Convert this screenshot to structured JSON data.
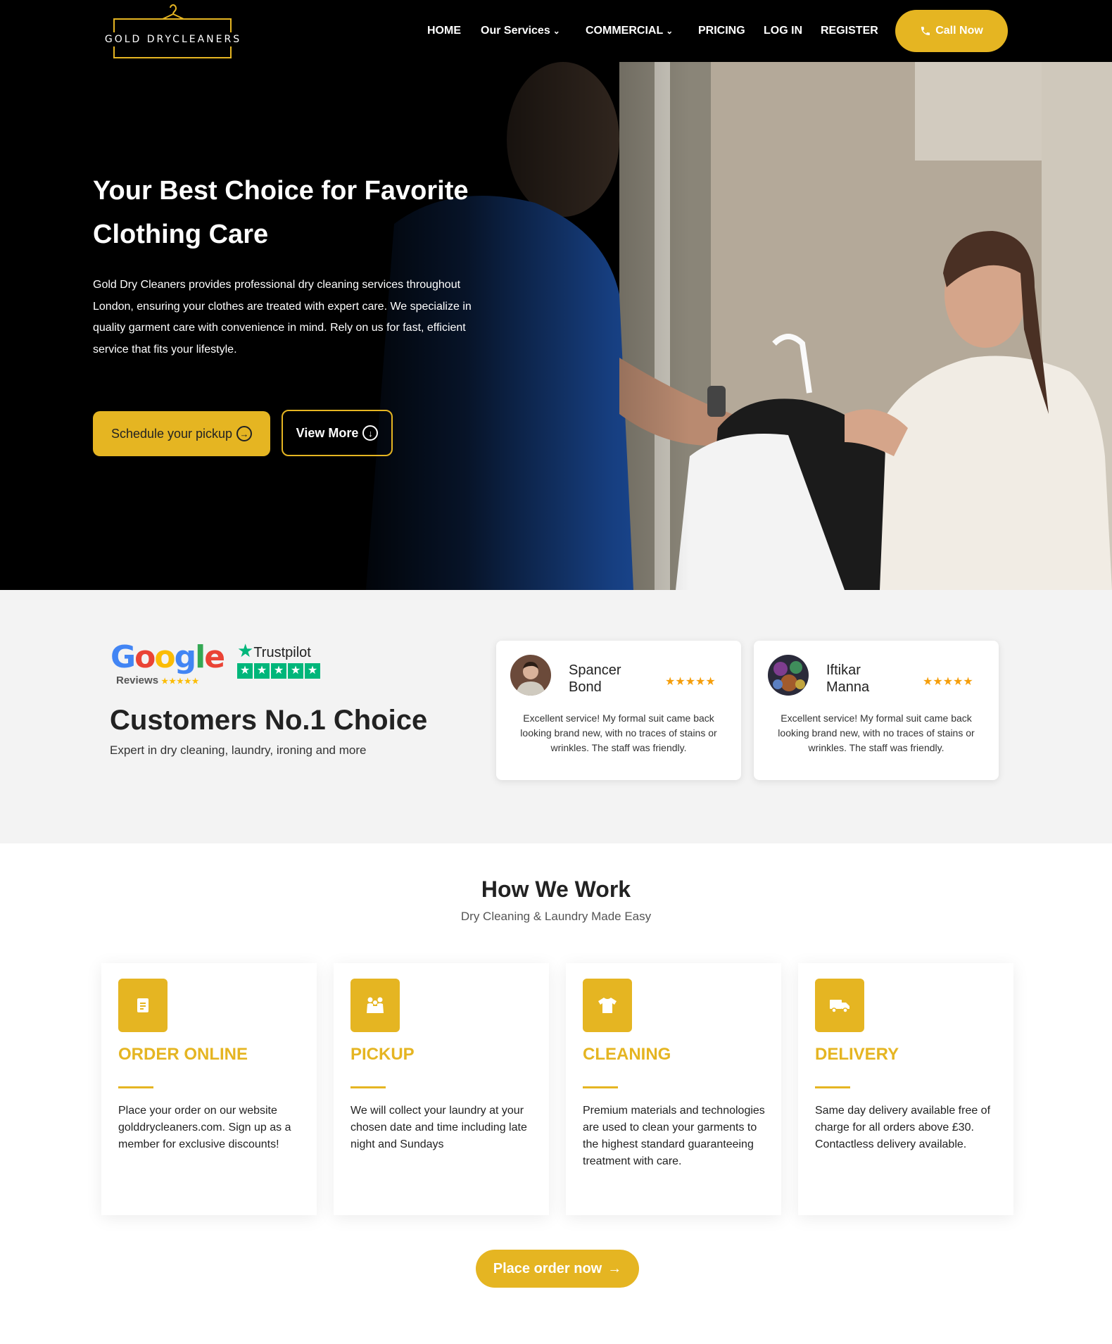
{
  "brand": {
    "logo_text": "GOLD DRYCLEANERS",
    "accent": "#e5b522"
  },
  "nav": {
    "items": [
      {
        "label": "HOME"
      },
      {
        "label": "Our Services"
      },
      {
        "label": "COMMERCIAL"
      },
      {
        "label": "PRICING"
      },
      {
        "label": "LOG IN"
      },
      {
        "label": "REGISTER"
      }
    ],
    "call_label": "Call Now"
  },
  "hero": {
    "title": "Your Best Choice for Favorite Clothing Care",
    "description": "Gold Dry Cleaners provides professional dry cleaning services throughout London, ensuring your clothes are treated with expert care. We specialize in quality garment care with convenience in mind. Rely on us for fast, efficient service that fits your lifestyle.",
    "schedule_label": "Schedule your pickup",
    "view_more_label": "View More"
  },
  "reviews": {
    "google_word": "Google",
    "google_sub": "Reviews",
    "trustpilot_word": "Trustpilot",
    "title": "Customers No.1 Choice",
    "subtitle": "Expert in dry cleaning, laundry, ironing and more",
    "cards": [
      {
        "name": "Spancer Bond",
        "rating": 5,
        "text": "Excellent service! My formal suit came back looking brand new, with no traces of stains or wrinkles. The staff was friendly."
      },
      {
        "name": "Iftikar Manna",
        "rating": 5,
        "text": "Excellent service! My formal suit came back looking brand new, with no traces of stains or wrinkles. The staff was friendly."
      }
    ]
  },
  "how": {
    "title": "How We Work",
    "subtitle": "Dry Cleaning & Laundry Made Easy",
    "steps": [
      {
        "title": "ORDER ONLINE",
        "icon": "document-icon",
        "text": "Place your order on our website golddrycleaners.com. Sign up as a member for exclusive discounts!"
      },
      {
        "title": "PICKUP",
        "icon": "people-icon",
        "text": "We will collect your laundry at your chosen date and time including late night and Sundays"
      },
      {
        "title": "CLEANING",
        "icon": "tshirt-icon",
        "text": "Premium materials and technologies are used to clean your garments to the highest standard guaranteeing treatment with care."
      },
      {
        "title": "DELIVERY",
        "icon": "truck-icon",
        "text": "Same day delivery available free of charge for all orders above £30. Contactless delivery available."
      }
    ],
    "cta_label": "Place order now"
  }
}
